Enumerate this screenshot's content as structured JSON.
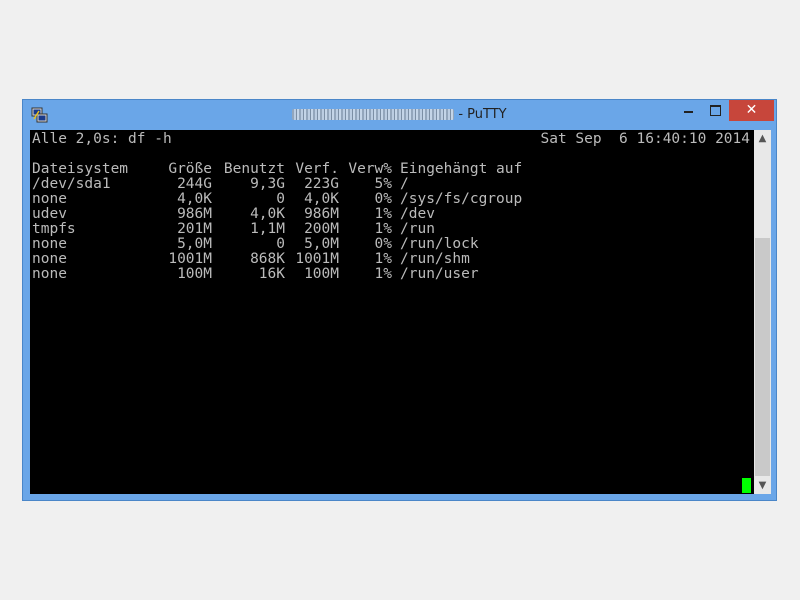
{
  "window": {
    "title_suffix": "- PuTTY",
    "close_label": "✕"
  },
  "terminal": {
    "command_line": "Alle 2,0s: df -h",
    "clock": "Sat Sep  6 16:40:10 2014",
    "columns": [
      "Dateisystem",
      "Größe",
      "Benutzt",
      "Verf.",
      "Verw%",
      "Eingehängt auf"
    ],
    "rows": [
      [
        "/dev/sda1",
        "244G",
        "9,3G",
        "223G",
        "5%",
        "/"
      ],
      [
        "none",
        "4,0K",
        "0",
        "4,0K",
        "0%",
        "/sys/fs/cgroup"
      ],
      [
        "udev",
        "986M",
        "4,0K",
        "986M",
        "1%",
        "/dev"
      ],
      [
        "tmpfs",
        "201M",
        "1,1M",
        "200M",
        "1%",
        "/run"
      ],
      [
        "none",
        "5,0M",
        "0",
        "5,0M",
        "0%",
        "/run/lock"
      ],
      [
        "none",
        "1001M",
        "868K",
        "1001M",
        "1%",
        "/run/shm"
      ],
      [
        "none",
        "100M",
        "16K",
        "100M",
        "1%",
        "/run/user"
      ]
    ],
    "cursor_color": "#00ff00",
    "fg_color": "#bbbbbb",
    "bg_color": "#000000"
  },
  "icons": {
    "app": "putty-icon",
    "minimize": "minimize-icon",
    "maximize": "maximize-icon",
    "close": "close-icon",
    "scroll_up": "chevron-up-icon",
    "scroll_down": "chevron-down-icon"
  }
}
